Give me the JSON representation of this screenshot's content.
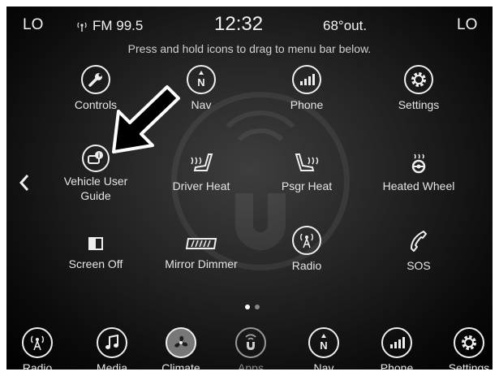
{
  "status_bar": {
    "left_temp": "LO",
    "radio_source": "FM 99.5",
    "clock": "12:32",
    "outside_temp": "68°out.",
    "right_temp": "LO"
  },
  "hint_text": "Press and hold icons to drag to menu bar below.",
  "apps": [
    {
      "label": "Controls",
      "icon": "wrench-icon"
    },
    {
      "label": "Nav",
      "icon": "compass-icon"
    },
    {
      "label": "Phone",
      "icon": "phone-signal-icon"
    },
    {
      "label": "Settings",
      "icon": "gear-icon"
    },
    {
      "label": "Vehicle User Guide",
      "icon": "vehicle-guide-icon"
    },
    {
      "label": "Driver Heat",
      "icon": "seat-heat-icon"
    },
    {
      "label": "Psgr Heat",
      "icon": "seat-heat-icon"
    },
    {
      "label": "Heated Wheel",
      "icon": "heated-wheel-icon"
    },
    {
      "label": "Screen Off",
      "icon": "screen-off-icon"
    },
    {
      "label": "Mirror Dimmer",
      "icon": "mirror-dimmer-icon"
    },
    {
      "label": "Radio",
      "icon": "radio-tower-icon"
    },
    {
      "label": "SOS",
      "icon": "phone-handset-icon"
    }
  ],
  "pager": {
    "pages": 2,
    "current": 1
  },
  "dock": [
    {
      "label": "Radio",
      "icon": "radio-tower-icon"
    },
    {
      "label": "Media",
      "icon": "music-note-icon"
    },
    {
      "label": "Climate",
      "icon": "fan-icon"
    },
    {
      "label": "Apps",
      "icon": "uconnect-icon",
      "active": true
    },
    {
      "label": "Nav",
      "icon": "compass-icon"
    },
    {
      "label": "Phone",
      "icon": "phone-signal-icon"
    },
    {
      "label": "Settings",
      "icon": "gear-icon"
    }
  ],
  "accent_color": "#e8e8e8"
}
